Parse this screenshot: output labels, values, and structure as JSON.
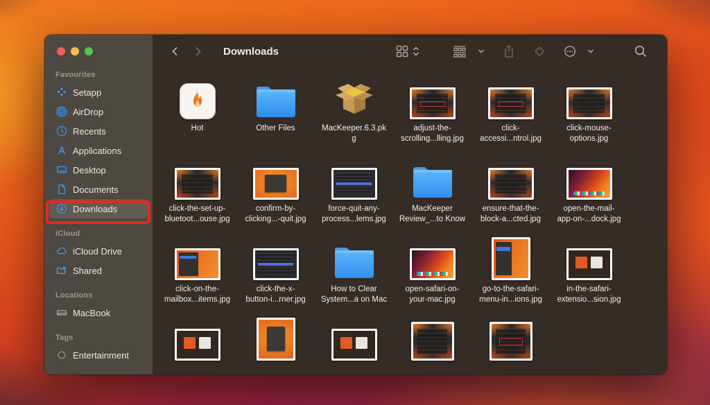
{
  "window": {
    "app": "Finder",
    "title": "Downloads"
  },
  "traffic_lights": {
    "close": "#f0605a",
    "minimize": "#f3bf4e",
    "zoom": "#56c44f"
  },
  "annotation": {
    "color": "#e32a1e",
    "target": "Downloads sidebar item"
  },
  "toolbar": {
    "title": "Downloads",
    "icons": [
      "back-chevron",
      "forward-chevron",
      "icon-view-grid",
      "view-updown-chevrons",
      "group-view",
      "group-chevron-down",
      "share",
      "tag",
      "more-options-ellipsis",
      "more-chevron-down",
      "search-magnifier"
    ]
  },
  "sidebar": {
    "sections": [
      {
        "label": "Favourites",
        "items": [
          {
            "label": "Setapp",
            "icon": "setapp-diamonds"
          },
          {
            "label": "AirDrop",
            "icon": "airdrop-waves"
          },
          {
            "label": "Recents",
            "icon": "clock"
          },
          {
            "label": "Applications",
            "icon": "applications-a"
          },
          {
            "label": "Desktop",
            "icon": "desktop-monitor"
          },
          {
            "label": "Documents",
            "icon": "document-page"
          },
          {
            "label": "Downloads",
            "icon": "download-circle",
            "selected": true,
            "annotated": true
          }
        ]
      },
      {
        "label": "iCloud",
        "items": [
          {
            "label": "iCloud Drive",
            "icon": "cloud"
          },
          {
            "label": "Shared",
            "icon": "shared-folder"
          }
        ]
      },
      {
        "label": "Locations",
        "items": [
          {
            "label": "MacBook",
            "icon": "internal-drive"
          }
        ]
      },
      {
        "label": "Tags",
        "items": [
          {
            "label": "Entertainment",
            "icon": "tag-circle-gray"
          }
        ]
      }
    ]
  },
  "files": [
    {
      "label": "Hot",
      "type": "app"
    },
    {
      "label": "Other Files",
      "type": "folder"
    },
    {
      "label": "MacKeeper.6.3.pk\ng",
      "type": "package"
    },
    {
      "label": "adjust-the-\nscrolling...lling.jpg",
      "type": "image",
      "preview": "dark-settings-red-box"
    },
    {
      "label": "click-\naccessi...ntrol.jpg",
      "type": "image",
      "preview": "dark-settings-red-box"
    },
    {
      "label": "click-mouse-\noptions.jpg",
      "type": "image",
      "preview": "dark-settings"
    },
    {
      "label": "click-the-set-up-\nbluetoot...ouse.jpg",
      "type": "image",
      "preview": "dark-settings"
    },
    {
      "label": "confirm-by-\nclicking...-quit.jpg",
      "type": "image",
      "preview": "alert-dialog"
    },
    {
      "label": "force-quit-any-\nprocess...lems.jpg",
      "type": "image",
      "preview": "dark-list-blue-row"
    },
    {
      "label": "MacKeeper\nReview_...to Know",
      "type": "folder"
    },
    {
      "label": "ensure-that-the-\nblock-a...cted.jpg",
      "type": "image",
      "preview": "dark-settings"
    },
    {
      "label": "open-the-mail-\napp-on-...dock.jpg",
      "type": "image",
      "preview": "desktop-with-dock"
    },
    {
      "label": "click-on-the-\nmailbox...items.jpg",
      "type": "image",
      "preview": "orange-menu-panel"
    },
    {
      "label": "click-the-x-\nbutton-i...rner.jpg",
      "type": "image",
      "preview": "dark-list-blue-row"
    },
    {
      "label": "How to Clear\nSystem...a on Mac",
      "type": "folder"
    },
    {
      "label": "open-safari-on-\nyour-mac.jpg",
      "type": "image",
      "preview": "desktop-with-dock"
    },
    {
      "label": "go-to-the-safari-\nmenu-in...ions.jpg",
      "type": "image",
      "preview": "orange-menu-panel-tall"
    },
    {
      "label": "in-the-safari-\nextensio...sion.jpg",
      "type": "image",
      "preview": "browser-cards"
    },
    {
      "label": "",
      "type": "image",
      "preview": "browser-cards"
    },
    {
      "label": "",
      "type": "image",
      "preview": "alert-dialog-tall"
    },
    {
      "label": "",
      "type": "image",
      "preview": "browser-cards"
    },
    {
      "label": "",
      "type": "image",
      "preview": "dark-settings-square"
    },
    {
      "label": "",
      "type": "image",
      "preview": "dark-settings-square-red"
    }
  ]
}
